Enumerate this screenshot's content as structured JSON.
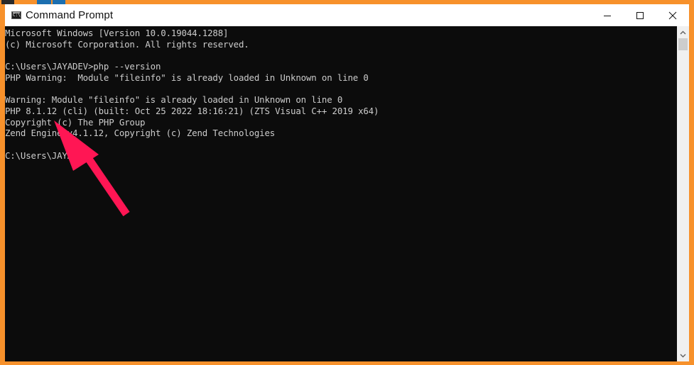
{
  "window": {
    "title": "Command Prompt",
    "app_icon": "cmd-icon",
    "controls": {
      "minimize": "minimize-icon",
      "maximize": "maximize-icon",
      "close": "close-icon"
    }
  },
  "console": {
    "lines": [
      "Microsoft Windows [Version 10.0.19044.1288]",
      "(c) Microsoft Corporation. All rights reserved.",
      "",
      "C:\\Users\\JAYADEV>php --version",
      "PHP Warning:  Module \"fileinfo\" is already loaded in Unknown on line 0",
      "",
      "Warning: Module \"fileinfo\" is already loaded in Unknown on line 0",
      "PHP 8.1.12 (cli) (built: Oct 25 2022 18:16:21) (ZTS Visual C++ 2019 x64)",
      "Copyright (c) The PHP Group",
      "Zend Engine v4.1.12, Copyright (c) Zend Technologies",
      "",
      "C:\\Users\\JAYADEV>"
    ],
    "text_color": "#cccccc",
    "background": "#0c0c0c"
  },
  "annotation": {
    "type": "arrow",
    "icon": "arrow-icon",
    "color": "#ff1654",
    "points_to": "PHP 8.1.12 (cli)"
  },
  "frame": {
    "border_color": "#f7912b"
  }
}
